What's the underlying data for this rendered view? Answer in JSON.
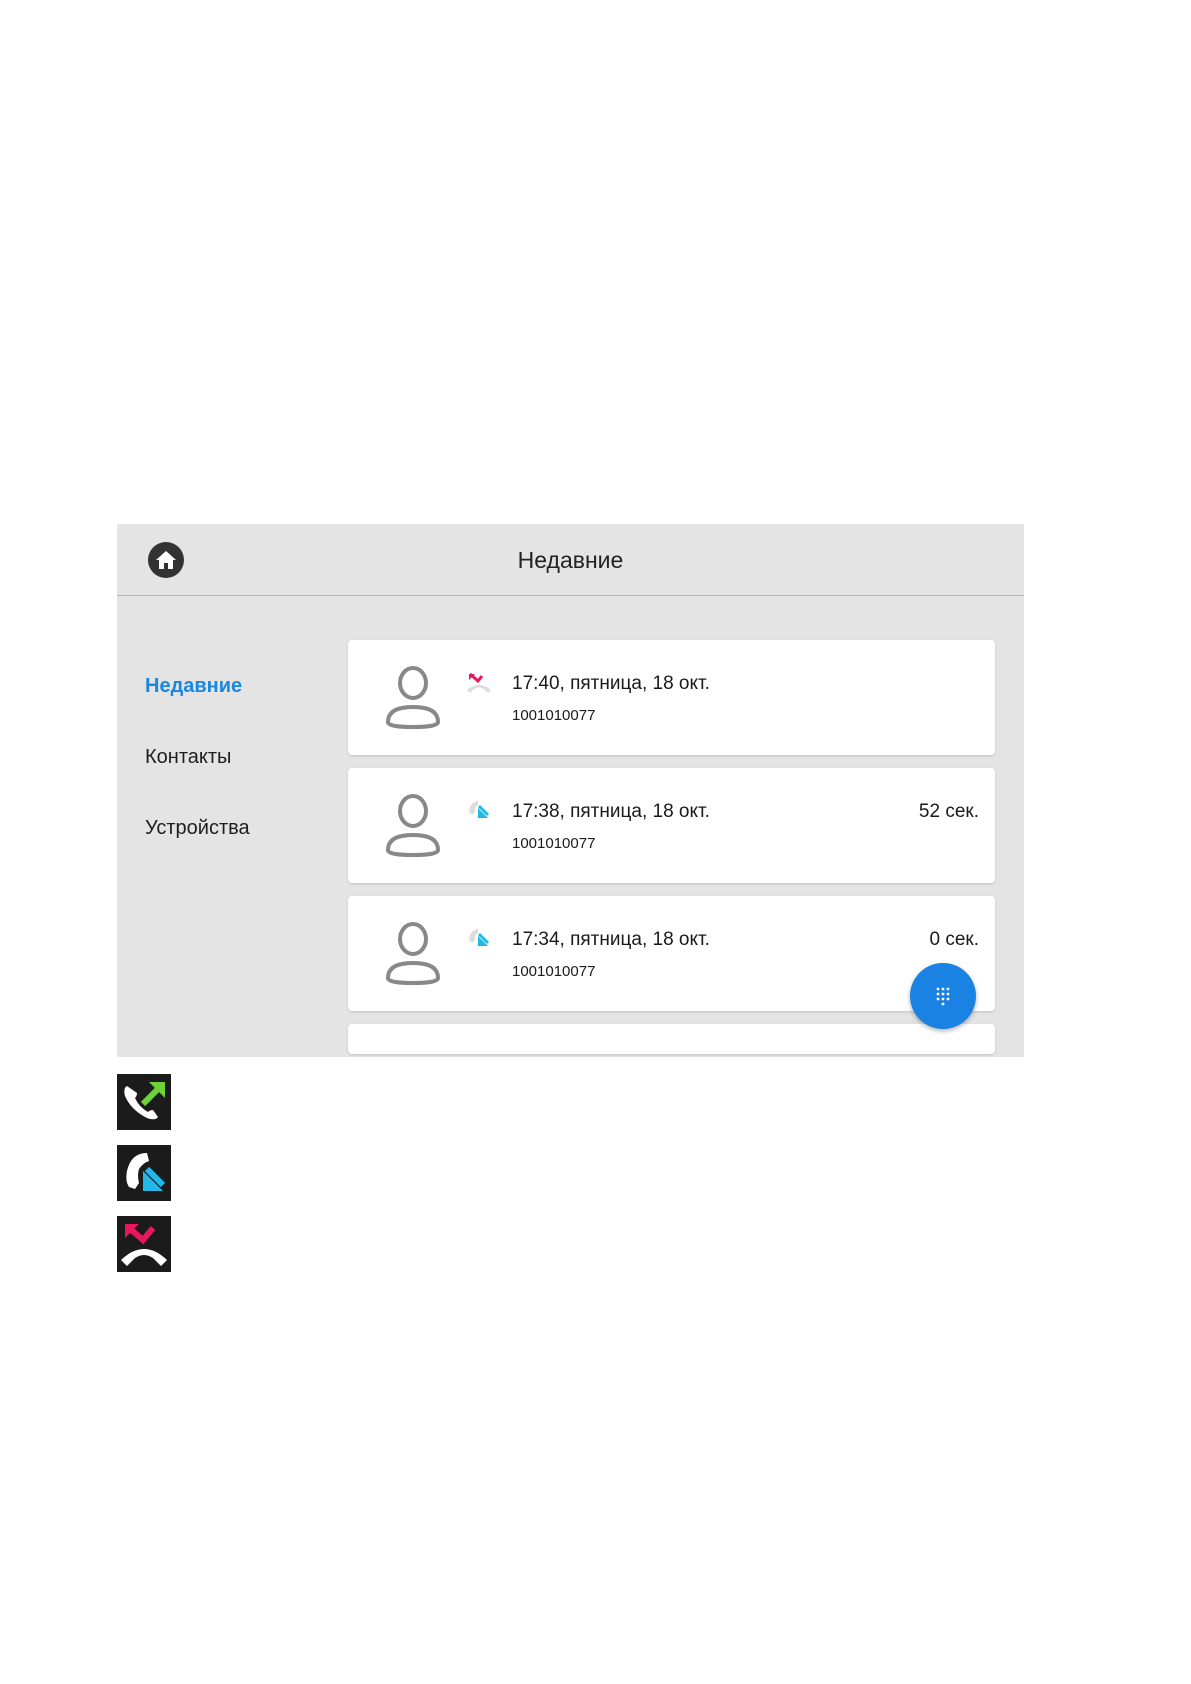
{
  "header": {
    "title": "Недавние"
  },
  "sidebar": {
    "items": [
      {
        "label": "Недавние",
        "active": true
      },
      {
        "label": "Контакты",
        "active": false
      },
      {
        "label": "Устройства",
        "active": false
      }
    ]
  },
  "calls": [
    {
      "type": "missed",
      "icon": "missed-call-icon",
      "time": "17:40, пятница, 18 окт.",
      "number": "1001010077",
      "duration": ""
    },
    {
      "type": "incoming",
      "icon": "incoming-call-icon",
      "time": "17:38, пятница, 18 окт.",
      "number": "1001010077",
      "duration": "52 сек."
    },
    {
      "type": "incoming",
      "icon": "incoming-call-icon",
      "time": "17:34, пятница, 18 окт.",
      "number": "1001010077",
      "duration": "0 сек."
    }
  ],
  "legend": [
    {
      "icon": "outgoing-call-icon",
      "color": "#6fd13a"
    },
    {
      "icon": "incoming-call-icon",
      "color": "#22b8e8"
    },
    {
      "icon": "missed-call-icon",
      "color": "#e8175d"
    }
  ],
  "colors": {
    "accent": "#1a87e0",
    "fab": "#1a82e2",
    "missed": "#e8175d",
    "incoming": "#22b8e8",
    "outgoing": "#6fd13a"
  }
}
